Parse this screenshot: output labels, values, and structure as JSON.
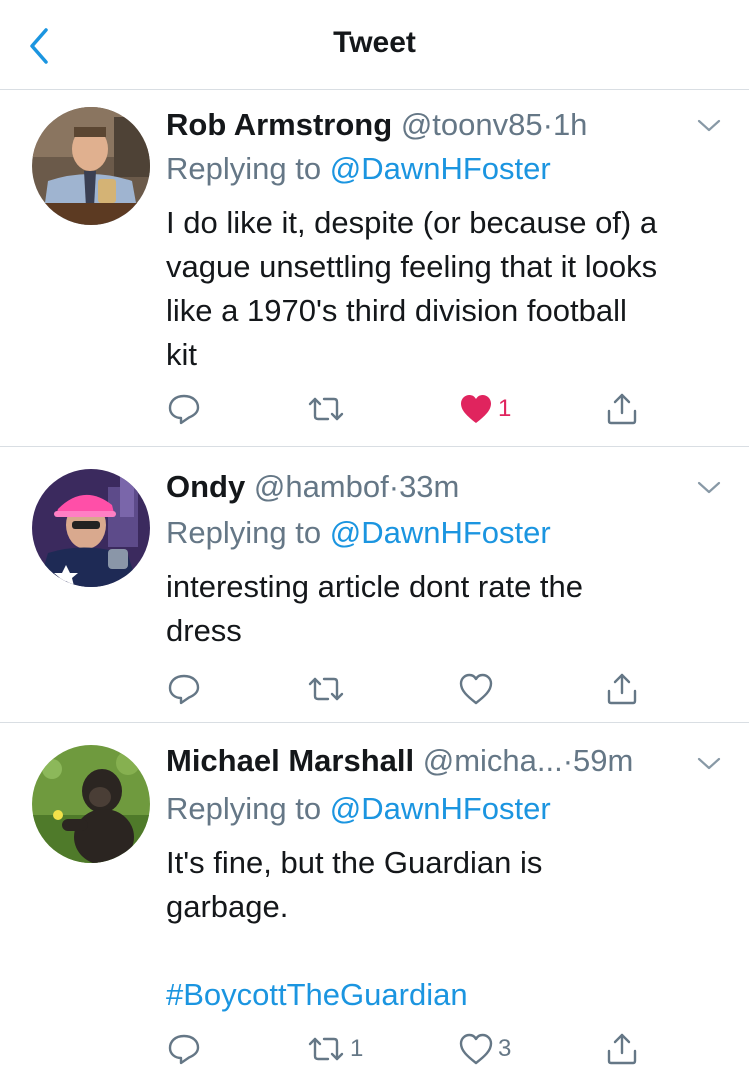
{
  "header": {
    "title": "Tweet",
    "back_icon": "chevron-left-icon"
  },
  "colors": {
    "link": "#1b95e0",
    "secondary": "#657786",
    "like": "#e0245e",
    "divider": "#d9dee3"
  },
  "tweets": [
    {
      "name": "Rob Armstrong",
      "handle": "@toonv85",
      "dot": "·",
      "time": "1h",
      "replying_prefix": "Replying to",
      "replying_to": "@DawnHFoster",
      "body_lines": [
        "I do like it, despite (or because of) a",
        "vague unsettling feeling that it looks",
        "like a 1970's third division football",
        "kit"
      ],
      "retweets": "",
      "likes": "1",
      "liked": true
    },
    {
      "name": "Ondy",
      "handle": "@hambof",
      "dot": "·",
      "time": "33m",
      "replying_prefix": "Replying to",
      "replying_to": "@DawnHFoster",
      "body_lines": [
        "interesting article dont rate the",
        "dress"
      ],
      "retweets": "",
      "likes": "",
      "liked": false
    },
    {
      "name": "Michael Marshall",
      "handle": "@micha...",
      "dot": "·",
      "time": "59m",
      "replying_prefix": "Replying to",
      "replying_to": "@DawnHFoster",
      "body_lines": [
        "It's fine, but the Guardian is",
        "garbage."
      ],
      "hashtag": "#BoycottTheGuardian",
      "retweets": "1",
      "likes": "3",
      "liked": false
    }
  ]
}
